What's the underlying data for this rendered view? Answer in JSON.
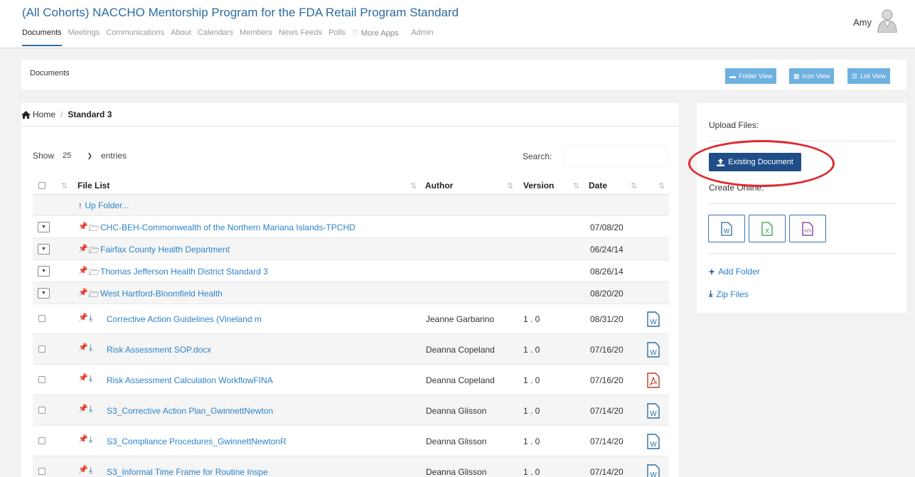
{
  "header": {
    "title": "(All Cohorts) NACCHO Mentorship Program for the FDA Retail Program Standard",
    "user_name": "Amy"
  },
  "nav": {
    "documents": "Documents",
    "meetings": "Meetings",
    "communications": "Communications",
    "about": "About",
    "calendars": "Calendars",
    "members": "Members",
    "news_feeds": "News Feeds",
    "polls": "Polls",
    "more_apps": "♡ More Apps",
    "admin": "Admin"
  },
  "docs_bar": {
    "title": "Documents",
    "folder_view": "Folder View",
    "icon_view": "Icon View",
    "list_view": "List View"
  },
  "breadcrumb": {
    "home": "Home",
    "current": "Standard 3"
  },
  "table_controls": {
    "show_label": "Show",
    "entries_value": "25",
    "entries_label": "entries",
    "search_label": "Search:",
    "search_value": ""
  },
  "table": {
    "columns": {
      "file_list": "File List",
      "author": "Author",
      "version": "Version",
      "date": "Date"
    },
    "up_folder": "Up Folder...",
    "folders": [
      {
        "name": "CHC-BEH-Commonwealth of the Northern Mariana Islands-TPCHD",
        "date": "07/08/20"
      },
      {
        "name": "Fairfax County Health Department",
        "date": "06/24/14"
      },
      {
        "name": "Thomas Jefferson Health District Standard 3",
        "date": "08/26/14"
      },
      {
        "name": "West Hartford-Bloomfield Health",
        "date": "08/20/20"
      }
    ],
    "files": [
      {
        "name": "Corrective Action Guidelines (Vineland m",
        "author": "Jeanne Garbarino",
        "version": "1 . 0",
        "date": "08/31/20",
        "type": "word"
      },
      {
        "name": "Risk Assessment SOP.docx",
        "author": "Deanna Copeland",
        "version": "1 . 0",
        "date": "07/16/20",
        "type": "word"
      },
      {
        "name": "Risk Assessment Calculation WorkflowFINA",
        "author": "Deanna Copeland",
        "version": "1 . 0",
        "date": "07/16/20",
        "type": "pdf"
      },
      {
        "name": "S3_Corrective Action Plan_GwinnettNewton",
        "author": "Deanna Glisson",
        "version": "1 . 0",
        "date": "07/14/20",
        "type": "word"
      },
      {
        "name": "S3_Compliance Procedures_GwinnettNewtonR",
        "author": "Deanna Glisson",
        "version": "1 . 0",
        "date": "07/14/20",
        "type": "word"
      },
      {
        "name": "S3_Informal Time Frame for Routine Inspe",
        "author": "Deanna Glisson",
        "version": "1 . 0",
        "date": "07/14/20",
        "type": "word"
      }
    ]
  },
  "side_panel": {
    "upload_title": "Upload Files:",
    "existing_document": "Existing Document",
    "create_online": "Create Online:",
    "add_folder": "Add Folder",
    "zip_files": "Zip Files"
  },
  "colors": {
    "brand": "#2d6ca2",
    "link": "#2d83c8",
    "view_button": "#6eb1e0",
    "primary_button": "#1f4d87",
    "highlight": "#e0292f",
    "pdf": "#c0392b",
    "excel": "#2e9e3e",
    "code": "#7b2d91"
  }
}
